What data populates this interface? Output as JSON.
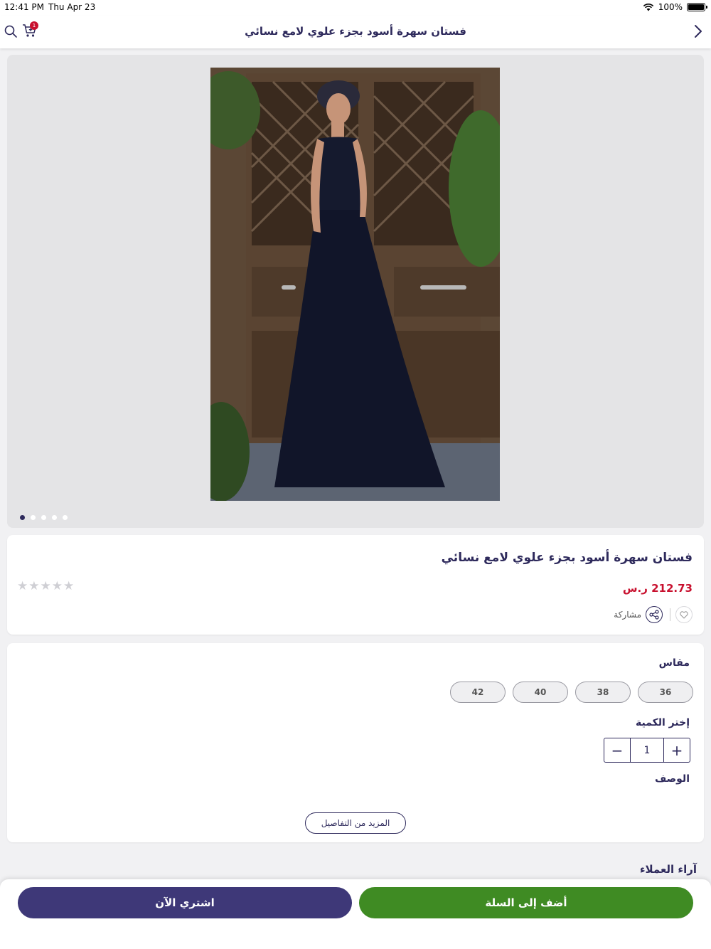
{
  "status_bar": {
    "time": "12:41 PM",
    "date": "Thu Apr 23",
    "battery": "100%",
    "battery_level": 1.0
  },
  "header": {
    "title": "فستان سهرة أسود بجزء علوي لامع نسائي",
    "cart_count": "1",
    "icons": {
      "back": "chevron-right-icon",
      "search": "search-icon",
      "cart": "cart-icon"
    }
  },
  "gallery": {
    "image_count": 5,
    "active_index": 0
  },
  "product": {
    "title": "فستان سهرة أسود بجزء علوي لامع نسائي",
    "price": "212.73 ر.س",
    "rating": 0,
    "rating_max": 5,
    "share_label": "مشاركة",
    "price_color": "#c8102e"
  },
  "options": {
    "size_label": "مقاس",
    "sizes": [
      "36",
      "38",
      "40",
      "42"
    ],
    "quantity_label": "إختر الكمية",
    "quantity": "1",
    "description_label": "الوصف",
    "more_details": "المزيد من التفاصيل"
  },
  "reviews": {
    "label": "آراء العملاء"
  },
  "actions": {
    "add_to_cart": "أضف إلى السلة",
    "buy_now": "اشتري الآن",
    "add_to_cart_color": "#3f8b23",
    "buy_now_color": "#3e3878"
  }
}
